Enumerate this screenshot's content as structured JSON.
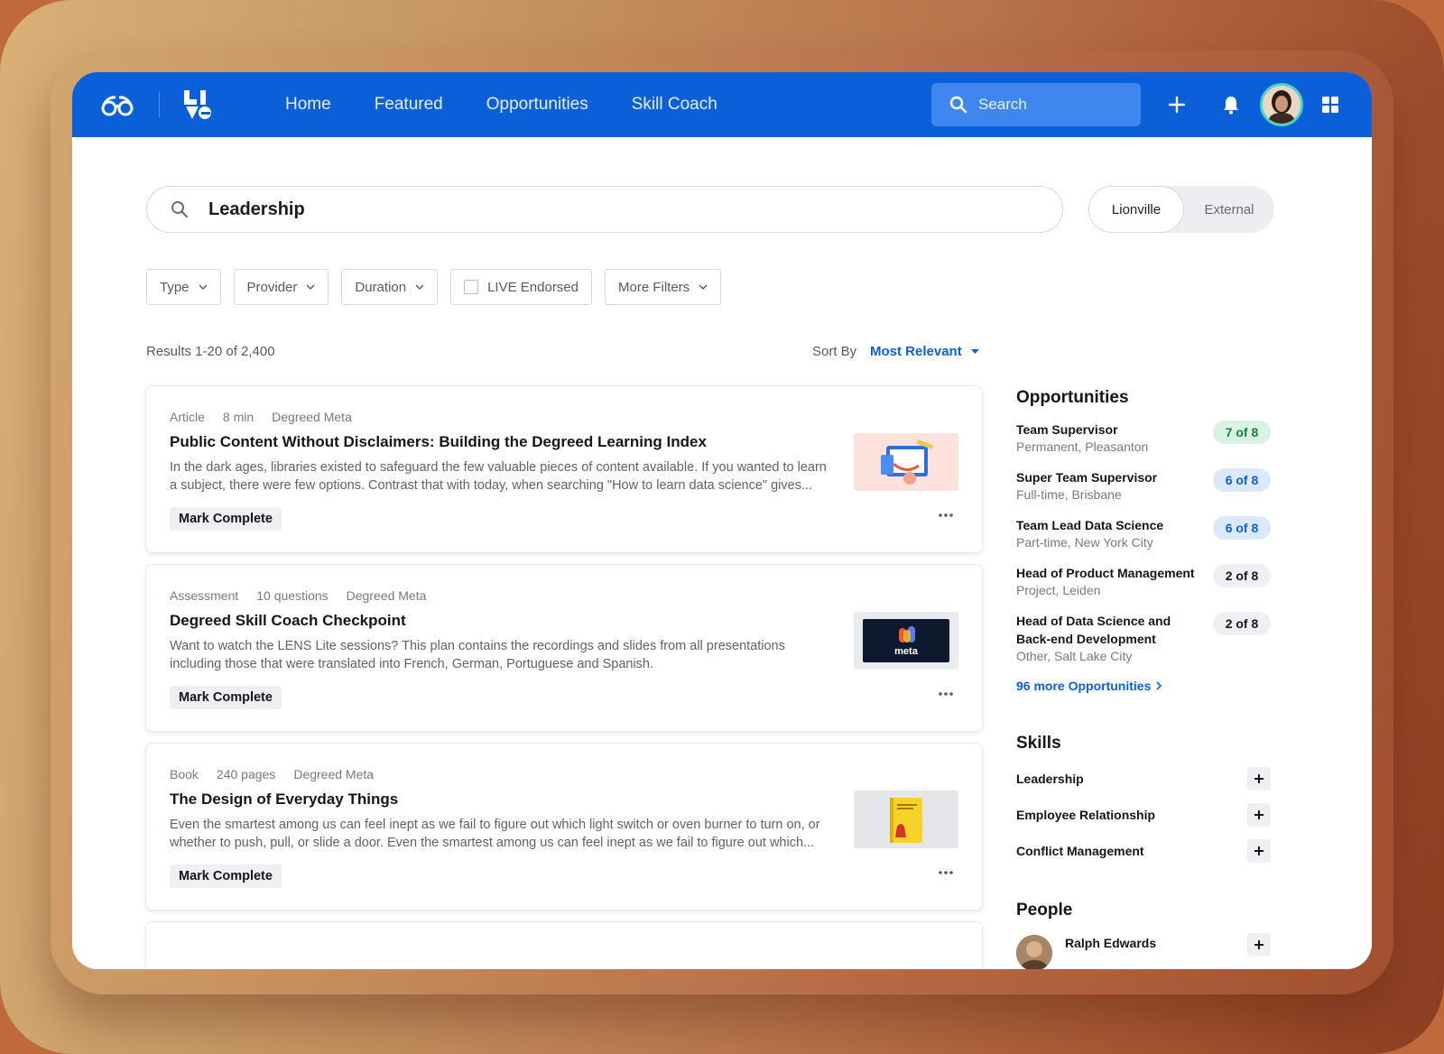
{
  "nav": {
    "items": [
      "Home",
      "Featured",
      "Opportunities",
      "Skill Coach"
    ],
    "search_placeholder": "Search"
  },
  "search": {
    "query": "Leadership"
  },
  "scope": {
    "options": [
      "Lionville",
      "External"
    ],
    "active": "Lionville"
  },
  "filters": [
    "Type",
    "Provider",
    "Duration",
    "LIVE Endorsed",
    "More Filters"
  ],
  "results": {
    "count_text": "Results 1-20 of 2,400",
    "sort_label": "Sort By",
    "sort_value": "Most Relevant"
  },
  "cards": [
    {
      "meta": [
        "Article",
        "8 min",
        "Degreed Meta"
      ],
      "title": "Public Content Without Disclaimers: Building the Degreed Learning Index",
      "desc": "In the dark ages, libraries existed to safeguard the few valuable pieces of content available. If you wanted to learn a subject, there were few options. Contrast that with today, when searching \"How to learn data science\" gives...",
      "action": "Mark Complete"
    },
    {
      "meta": [
        "Assessment",
        "10 questions",
        "Degreed Meta"
      ],
      "title": "Degreed Skill Coach Checkpoint",
      "desc": "Want to watch the LENS Lite sessions? This plan contains the recordings and slides from all presentations including those that were translated into French, German, Portuguese and Spanish.",
      "action": "Mark Complete",
      "thumb_text": "meta"
    },
    {
      "meta": [
        "Book",
        "240 pages",
        "Degreed Meta"
      ],
      "title": "The Design of Everyday Things",
      "desc": "Even the smartest among us can feel inept as we fail to figure out which light switch or oven burner to turn on, or whether to push, pull, or slide a door. Even the smartest among us can feel inept as we fail to figure out which...",
      "action": "Mark Complete"
    }
  ],
  "opportunities": {
    "title": "Opportunities",
    "items": [
      {
        "title": "Team Supervisor",
        "sub": "Permanent, Pleasanton",
        "badge": "7 of 8"
      },
      {
        "title": "Super Team Supervisor",
        "sub": "Full-time, Brisbane",
        "badge": "6 of 8"
      },
      {
        "title": "Team Lead Data Science",
        "sub": "Part-time, New York City",
        "badge": "6 of 8"
      },
      {
        "title": "Head of Product Management",
        "sub": "Project, Leiden",
        "badge": "2 of 8"
      },
      {
        "title": "Head of Data Science and Back-end Development",
        "sub": "Other, Salt Lake City",
        "badge": "2 of 8"
      }
    ],
    "more": "96 more Opportunities",
    "colors": {
      "high_bg": "#d8f3e3",
      "high_fg": "#1a7f45",
      "mid_bg": "#dce9fd",
      "mid_fg": "#0b5fd9",
      "low_bg": "#eef0f3",
      "low_fg": "#14161a"
    }
  },
  "skills": {
    "title": "Skills",
    "items": [
      "Leadership",
      "Employee Relationship",
      "Conflict Management"
    ]
  },
  "people": {
    "title": "People",
    "items": [
      "Ralph Edwards"
    ]
  },
  "brand": {
    "primary": "#0b5fd9"
  }
}
